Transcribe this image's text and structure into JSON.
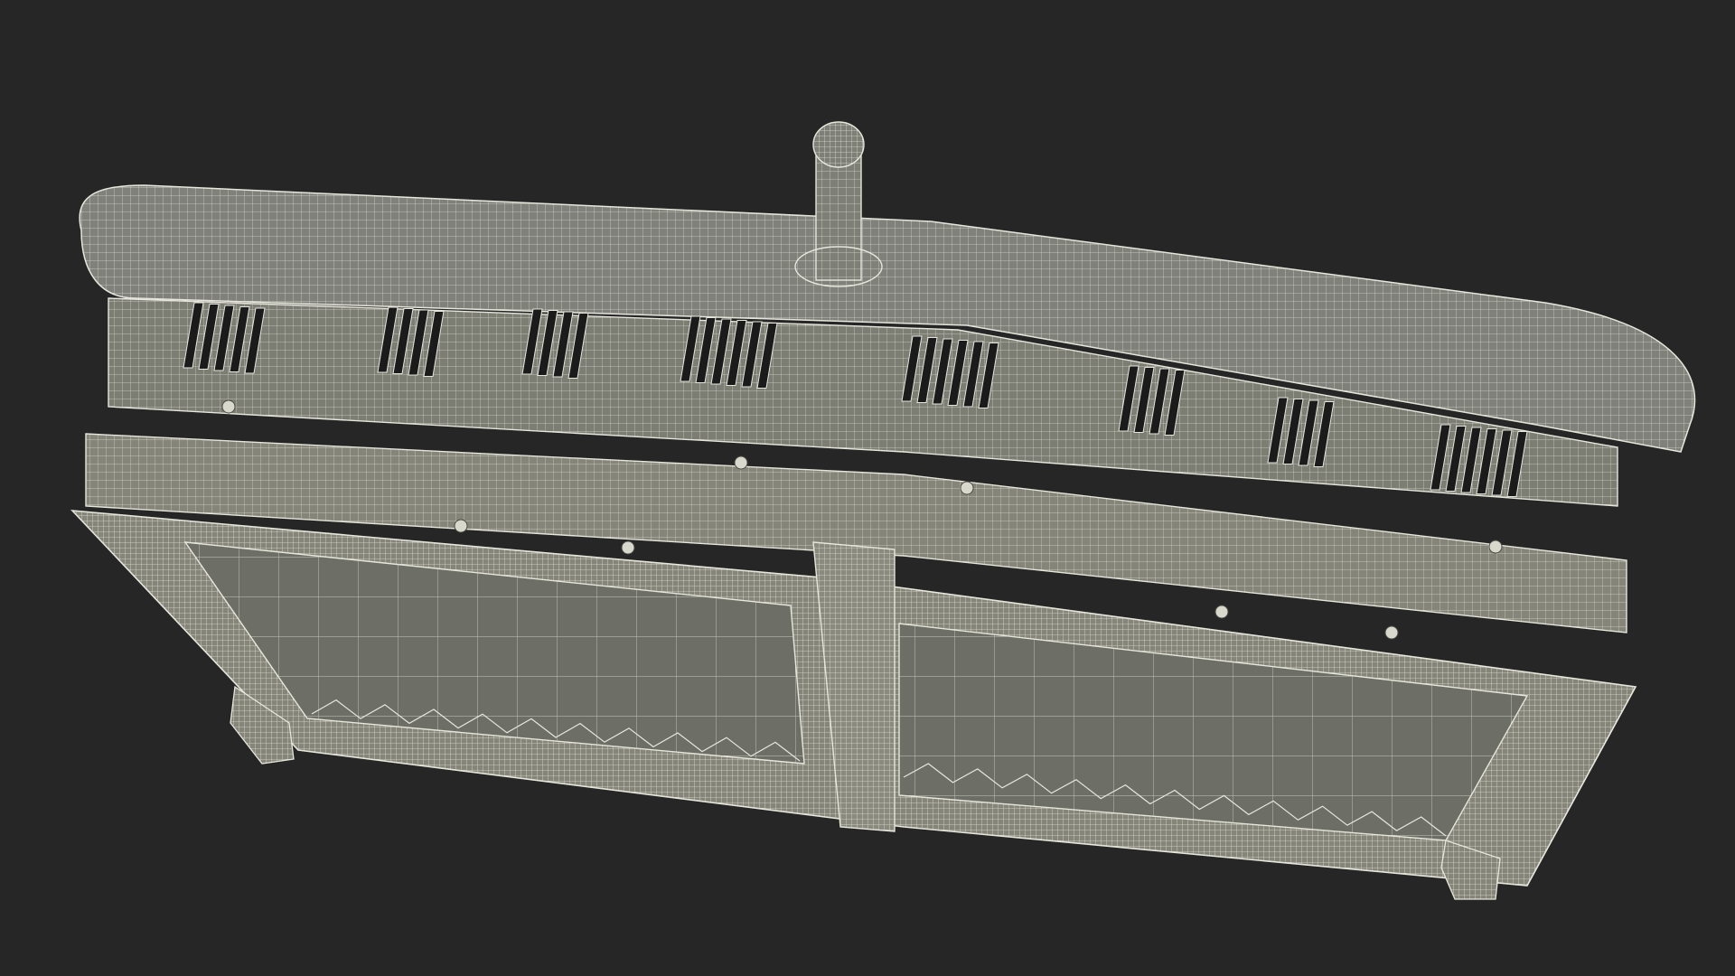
{
  "scene": {
    "background_color": "#262626",
    "wire_color": "#e6e6dc",
    "panel_color": "#6d6e65",
    "frame_color": "#858679",
    "slot_color": "#1b1b1b"
  }
}
